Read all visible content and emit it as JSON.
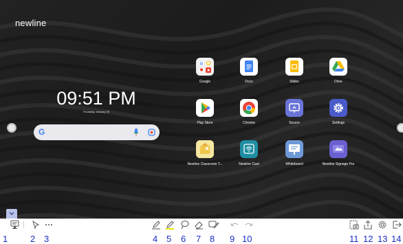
{
  "brand": "newline",
  "clock": {
    "time": "09:51 PM",
    "date": "Thursday, January 29"
  },
  "search": {
    "logo": "G",
    "icons": [
      "mic-icon",
      "lens-icon"
    ]
  },
  "apps": [
    {
      "label": "Google",
      "icon": "google-folder-icon"
    },
    {
      "label": "Docs",
      "icon": "docs-icon"
    },
    {
      "label": "Slides",
      "icon": "slides-icon"
    },
    {
      "label": "Drive",
      "icon": "drive-icon"
    },
    {
      "label": "Play Store",
      "icon": "play-store-icon"
    },
    {
      "label": "Chrome",
      "icon": "chrome-icon"
    },
    {
      "label": "Source",
      "icon": "source-icon"
    },
    {
      "label": "Settings",
      "icon": "settings-icon"
    },
    {
      "label": "Newline Classroom T...",
      "icon": "classroom-icon"
    },
    {
      "label": "Newline Cast",
      "icon": "cast-icon"
    },
    {
      "label": "Whiteboard",
      "icon": "whiteboard-icon"
    },
    {
      "label": "Newline Signage Pro",
      "icon": "signage-icon"
    }
  ],
  "toolbar": {
    "tools": [
      "chat-icon",
      "pointer-icon",
      "more-icon",
      "pen-icon",
      "highlighter-icon",
      "lasso-icon",
      "eraser-icon",
      "annotate-icon",
      "undo-icon",
      "redo-icon",
      "screenshot-icon",
      "share-icon",
      "settings-icon",
      "exit-icon"
    ],
    "numbers": [
      "1",
      "2",
      "3",
      "4",
      "5",
      "6",
      "7",
      "8",
      "9",
      "10",
      "11",
      "12",
      "13",
      "14"
    ]
  },
  "colors": {
    "annotation": "#1a2ec4",
    "highlight": "#e6e600",
    "background": "#222222"
  }
}
